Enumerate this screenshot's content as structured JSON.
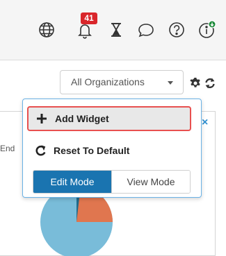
{
  "navbar": {
    "notification_count": "41",
    "icons": [
      "globe-icon",
      "bell-icon",
      "hourglass-icon",
      "chat-bubble-icon",
      "help-icon",
      "info-icon"
    ]
  },
  "toolbar": {
    "org_select_value": "All Organizations",
    "icons": [
      "gear-icon",
      "refresh-icon"
    ]
  },
  "widget": {
    "partial_label": "End",
    "chart_colors": {
      "primary": "#79bcd9",
      "secondary": "#e0764f"
    }
  },
  "menu": {
    "add_widget_label": "Add Widget",
    "reset_label": "Reset To Default",
    "modes": [
      {
        "label": "Edit Mode",
        "active": true
      },
      {
        "label": "View Mode",
        "active": false
      }
    ]
  },
  "colors": {
    "accent": "#1a74b0",
    "badge": "#d9262b",
    "highlight_border": "#e8504f",
    "menu_border": "#6ab2e6"
  }
}
